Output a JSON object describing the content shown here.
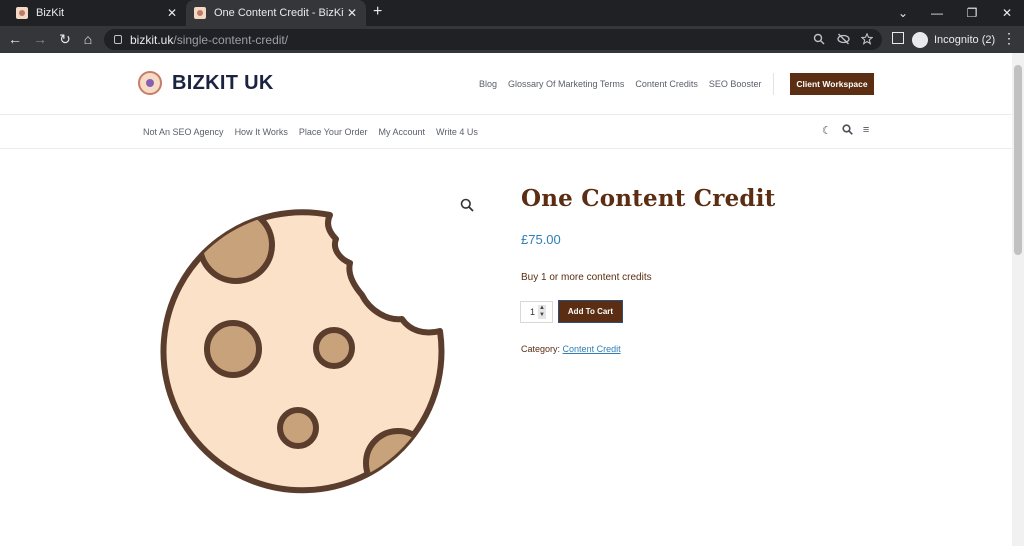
{
  "browser": {
    "tabs": [
      {
        "title": "BizKit",
        "close": "✕"
      },
      {
        "title": "One Content Credit - BizKit UK",
        "close": "✕"
      }
    ],
    "new_tab": "+",
    "window_controls": {
      "collapse": "⌄",
      "minimize": "—",
      "restore": "❐",
      "close": "✕"
    },
    "nav": {
      "back": "←",
      "forward": "→",
      "reload": "↻",
      "home": "⌂"
    },
    "address": {
      "host": "bizkit.uk",
      "path": "/single-content-credit/"
    },
    "incognito_label": "Incognito (2)",
    "menu": "⋮"
  },
  "site": {
    "brand": "BIZKIT UK",
    "top_nav": [
      "Blog",
      "Glossary Of Marketing Terms",
      "Content Credits",
      "SEO Booster"
    ],
    "cta": "Client Workspace",
    "sub_nav": [
      "Not An SEO Agency",
      "How It Works",
      "Place Your Order",
      "My Account",
      "Write 4 Us"
    ],
    "header_icons": {
      "theme": "☾",
      "search": "⚲",
      "menu": "≡"
    }
  },
  "product": {
    "title": "One Content Credit",
    "price": "£75.00",
    "description": "Buy 1 or more content credits",
    "quantity": "1",
    "add_to_cart": "Add To Cart",
    "category_label": "Category:",
    "category": "Content Credit",
    "zoom_icon": "🔍"
  },
  "colors": {
    "brand_brown": "#5b2d12",
    "link_blue": "#2e7fb8",
    "cookie_fill": "#fae1c8",
    "cookie_chip": "#c8a27a",
    "cookie_outline": "#5a3d2c"
  }
}
